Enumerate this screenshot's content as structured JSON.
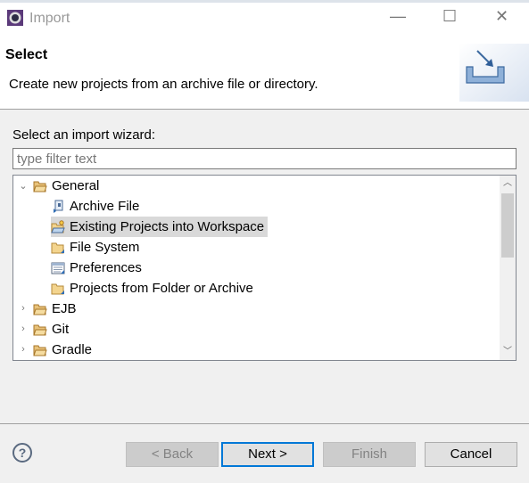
{
  "window": {
    "title": "Import",
    "minimize": "—",
    "maximize": "☐",
    "close": "✕"
  },
  "header": {
    "title": "Select",
    "description": "Create new projects from an archive file or directory.",
    "icon": "import-wizard-icon"
  },
  "wizard": {
    "label": "Select an import wizard:",
    "filter_placeholder": "type filter text",
    "filter_value": ""
  },
  "tree": [
    {
      "label": "General",
      "level": 0,
      "expanded": true,
      "icon": "folder-open"
    },
    {
      "label": "Archive File",
      "level": 1,
      "icon": "archive"
    },
    {
      "label": "Existing Projects into Workspace",
      "level": 1,
      "icon": "project-folder",
      "selected": true
    },
    {
      "label": "File System",
      "level": 1,
      "icon": "folder"
    },
    {
      "label": "Preferences",
      "level": 1,
      "icon": "preferences"
    },
    {
      "label": "Projects from Folder or Archive",
      "level": 1,
      "icon": "folder"
    },
    {
      "label": "EJB",
      "level": 0,
      "expanded": false,
      "icon": "folder-open"
    },
    {
      "label": "Git",
      "level": 0,
      "expanded": false,
      "icon": "folder-open"
    },
    {
      "label": "Gradle",
      "level": 0,
      "expanded": false,
      "icon": "folder-open"
    }
  ],
  "buttons": {
    "help": "?",
    "back": "< Back",
    "next": "Next >",
    "finish": "Finish",
    "cancel": "Cancel"
  },
  "colors": {
    "focus": "#0078d7",
    "selection": "#d9d9d9"
  }
}
